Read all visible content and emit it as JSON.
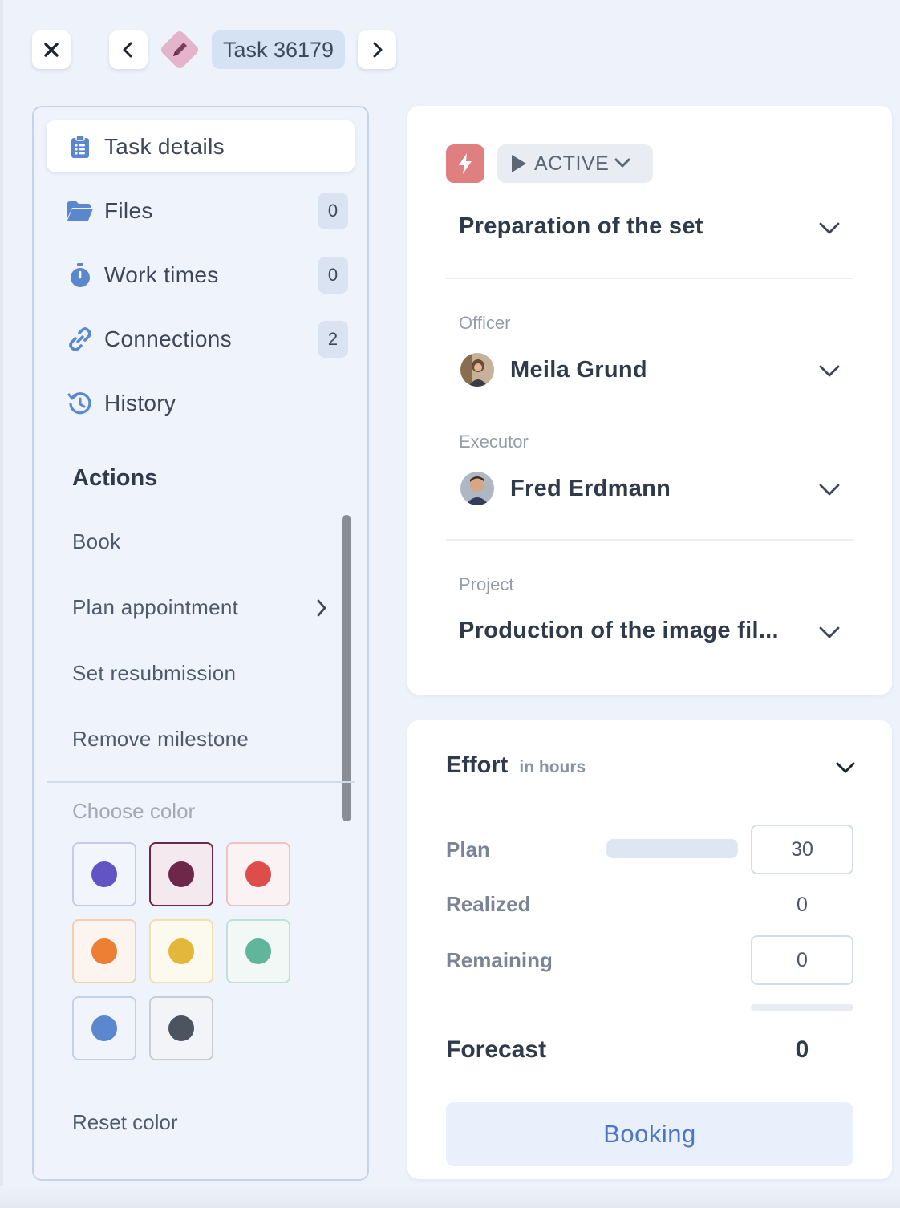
{
  "toolbar": {
    "close_icon": "close-icon",
    "prev_icon": "chevron-left-icon",
    "next_icon": "chevron-right-icon",
    "task_type_icon": "pencil-icon",
    "task_label": "Task 36179"
  },
  "sidebar": {
    "items": [
      {
        "label": "Task details",
        "icon": "clipboard-icon"
      },
      {
        "label": "Files",
        "icon": "folder-icon",
        "count": "0"
      },
      {
        "label": "Work times",
        "icon": "stopwatch-icon",
        "count": "0"
      },
      {
        "label": "Connections",
        "icon": "link-icon",
        "count": "2"
      },
      {
        "label": "History",
        "icon": "history-icon"
      }
    ],
    "actions_title": "Actions",
    "actions": [
      "Book",
      "Plan appointment",
      "Set resubmission",
      "Remove milestone"
    ],
    "choose_color_label": "Choose color",
    "colors": [
      {
        "dot": "#6354c4",
        "border": "#c6cbe9",
        "bg": "#f3f5fc"
      },
      {
        "dot": "#6e2748",
        "border": "#6e2748",
        "bg": "#f4e9ee"
      },
      {
        "dot": "#de4d49",
        "border": "#efc3c1",
        "bg": "#fbf3f3"
      },
      {
        "dot": "#ec7f33",
        "border": "#f2cfae",
        "bg": "#fcf5ef"
      },
      {
        "dot": "#e3b63c",
        "border": "#efe0b0",
        "bg": "#fcf9ef"
      },
      {
        "dot": "#5fb69a",
        "border": "#bfe2d6",
        "bg": "#f1f8f5"
      },
      {
        "dot": "#5b87cf",
        "border": "#c1d2ec",
        "bg": "#f1f5fb"
      },
      {
        "dot": "#4c5460",
        "border": "#c9cdd4",
        "bg": "#f3f4f7"
      }
    ],
    "reset_color_label": "Reset color"
  },
  "details": {
    "priority_icon": "lightning-icon",
    "status": "ACTIVE",
    "title": "Preparation of the set",
    "officer_label": "Officer",
    "officer_name": "Meila Grund",
    "executor_label": "Executor",
    "executor_name": "Fred Erdmann",
    "project_label": "Project",
    "project_name": "Production of the image fil..."
  },
  "effort": {
    "title": "Effort",
    "unit": "in hours",
    "plan_label": "Plan",
    "plan_value": "30",
    "realized_label": "Realized",
    "realized_value": "0",
    "remaining_label": "Remaining",
    "remaining_value": "0",
    "forecast_label": "Forecast",
    "forecast_value": "0",
    "booking_label": "Booking"
  },
  "colors": {
    "accent": "#4d77c2",
    "priority": "#e07f7f",
    "task_icon_bg": "#e4b3cc"
  }
}
